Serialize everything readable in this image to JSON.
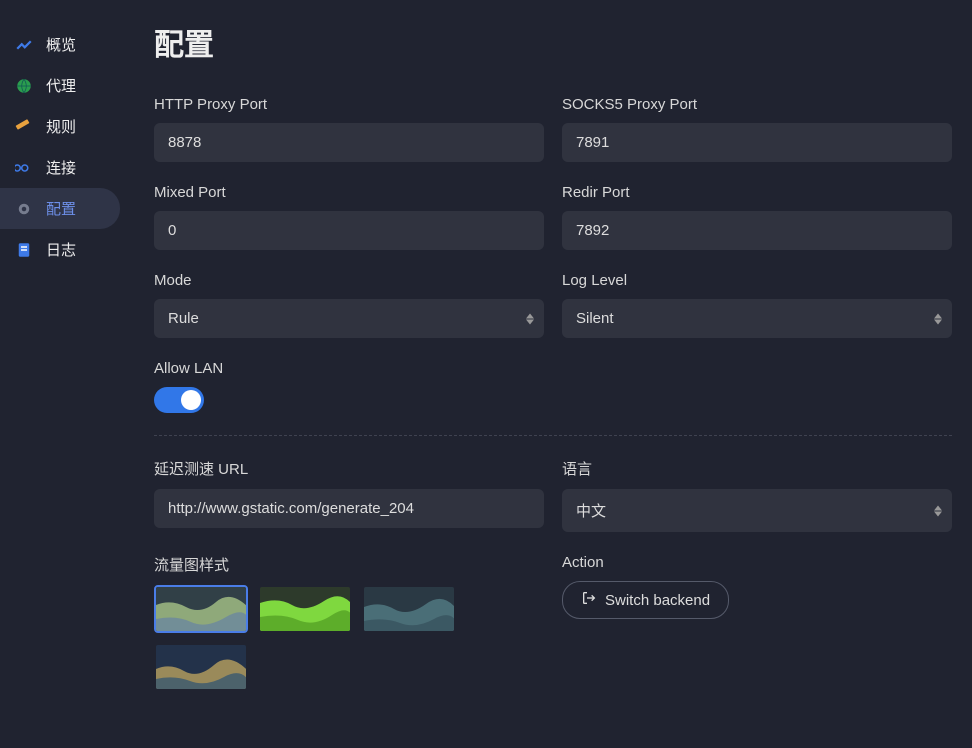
{
  "sidebar": {
    "items": [
      {
        "label": "概览",
        "icon": "chart-icon"
      },
      {
        "label": "代理",
        "icon": "globe-icon"
      },
      {
        "label": "规则",
        "icon": "ruler-icon"
      },
      {
        "label": "连接",
        "icon": "link-icon"
      },
      {
        "label": "配置",
        "icon": "gear-icon"
      },
      {
        "label": "日志",
        "icon": "file-icon"
      }
    ]
  },
  "page": {
    "title": "配置"
  },
  "fields": {
    "http_proxy_port": {
      "label": "HTTP Proxy Port",
      "value": "8878"
    },
    "socks5_proxy_port": {
      "label": "SOCKS5 Proxy Port",
      "value": "7891"
    },
    "mixed_port": {
      "label": "Mixed Port",
      "value": "0"
    },
    "redir_port": {
      "label": "Redir Port",
      "value": "7892"
    },
    "mode": {
      "label": "Mode",
      "value": "Rule"
    },
    "log_level": {
      "label": "Log Level",
      "value": "Silent"
    },
    "allow_lan": {
      "label": "Allow LAN",
      "value": true
    },
    "latency_url": {
      "label": "延迟测速 URL",
      "value": "http://www.gstatic.com/generate_204"
    },
    "language": {
      "label": "语言",
      "value": "中文"
    },
    "chart_style": {
      "label": "流量图样式"
    },
    "action": {
      "label": "Action",
      "button": "Switch backend"
    }
  }
}
